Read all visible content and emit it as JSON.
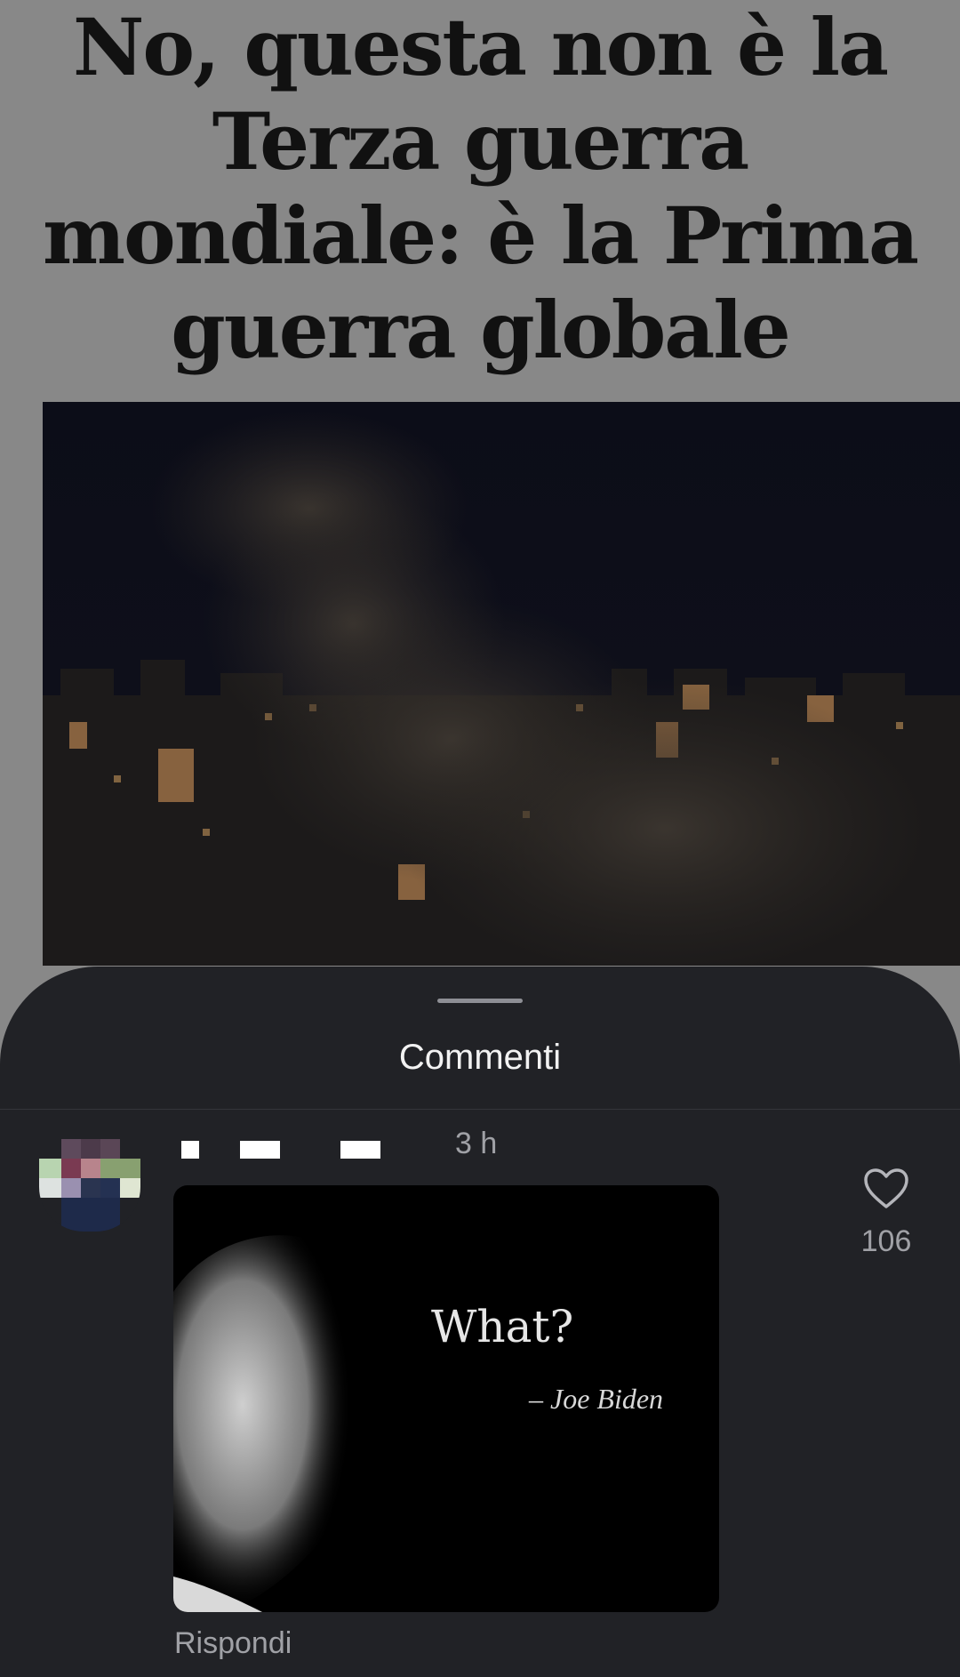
{
  "article": {
    "title": "No, questa non è la Terza guerra mondiale: è la Prima guerra globale"
  },
  "comments_sheet": {
    "title": "Commenti"
  },
  "comment": {
    "timestamp": "3 h",
    "meme": {
      "quote": "What?",
      "author": "– Joe Biden"
    },
    "likes": "106",
    "reply_label": "Rispondi"
  },
  "colors": {
    "page_background": "#888888",
    "sheet_background": "#212226",
    "muted_text": "#a0a1a6"
  },
  "icons": [
    "heart-icon"
  ]
}
